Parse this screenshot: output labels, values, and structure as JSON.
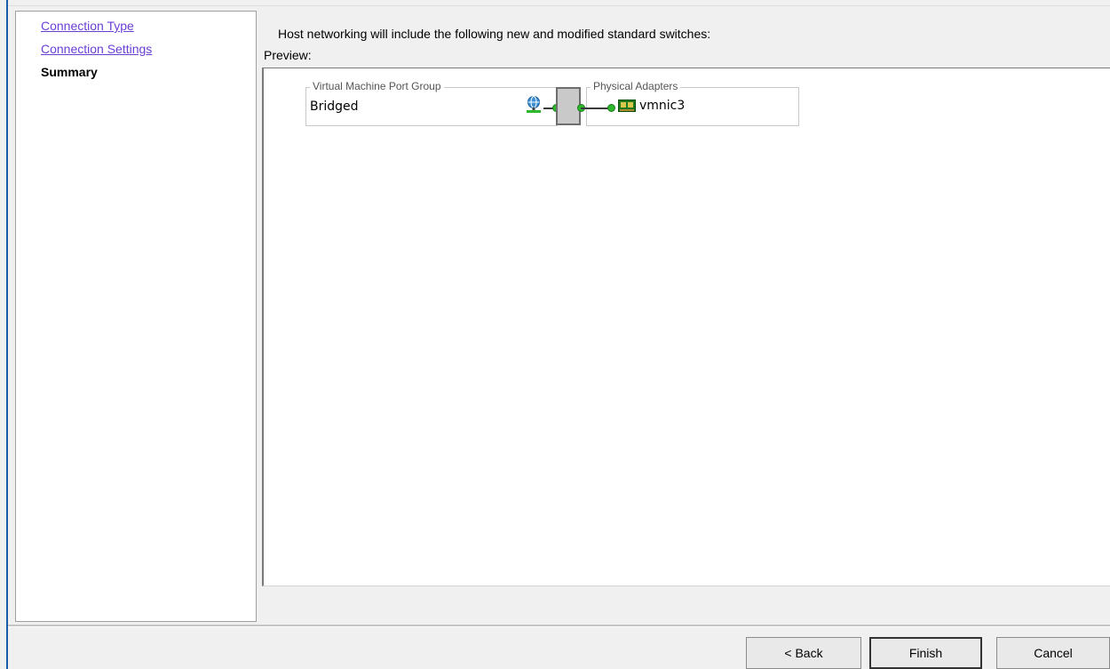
{
  "nav": {
    "items": [
      {
        "label": "Connection Type",
        "state": "link"
      },
      {
        "label": "Connection Settings",
        "state": "link"
      },
      {
        "label": "Summary",
        "state": "current"
      }
    ]
  },
  "summary": {
    "intro": "Host networking will include the following new and modified standard switches:",
    "preview_label": "Preview:"
  },
  "diagram": {
    "port_group": {
      "legend": "Virtual Machine Port Group",
      "name": "Bridged",
      "icon": "vm-network-icon"
    },
    "adapters": {
      "legend": "Physical Adapters",
      "name": "vmnic3",
      "icon": "nic-icon"
    },
    "colors": {
      "port_dot": "#2eb82e",
      "switch": "#c9c9c9"
    }
  },
  "buttons": {
    "back": "< Back",
    "finish": "Finish",
    "cancel": "Cancel"
  }
}
